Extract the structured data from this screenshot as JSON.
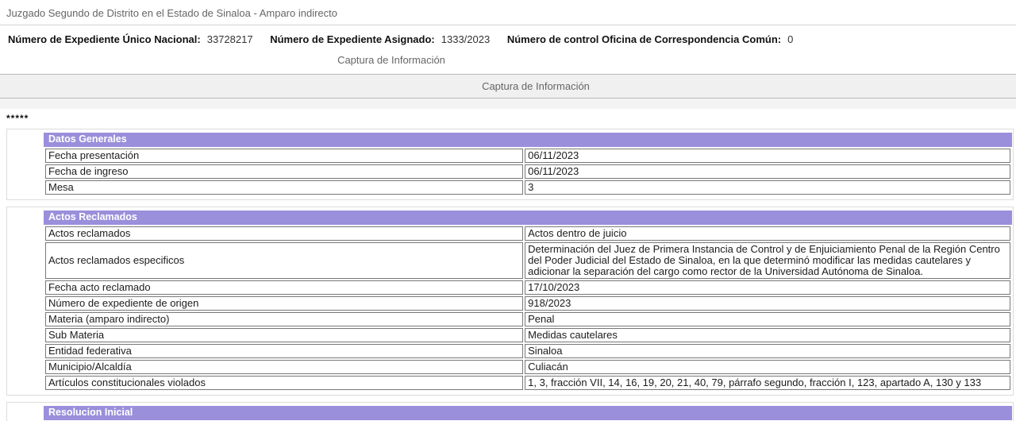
{
  "header": {
    "court_title": "Juzgado Segundo de Distrito en el Estado de Sinaloa - Amparo indirecto",
    "fields": [
      {
        "label": "Número de Expediente Único Nacional:",
        "value": "33728217"
      },
      {
        "label": "Número de Expediente Asignado:",
        "value": "1333/2023"
      },
      {
        "label": "Número de control Oficina de Correspondencia Común:",
        "value": "0"
      }
    ],
    "page_subtitle": "Captura de Información",
    "panel_tab": "Captura de Información",
    "asterisks": "*****"
  },
  "sections": [
    {
      "title": "Datos Generales",
      "rows": [
        {
          "label": "Fecha presentación",
          "value": "06/11/2023"
        },
        {
          "label": "Fecha de ingreso",
          "value": "06/11/2023"
        },
        {
          "label": "Mesa",
          "value": "3"
        }
      ]
    },
    {
      "title": "Actos Reclamados",
      "rows": [
        {
          "label": "Actos reclamados",
          "value": "Actos dentro de juicio"
        },
        {
          "label": "Actos reclamados especificos",
          "value": "Determinación del Juez de Primera Instancia de Control y de Enjuiciamiento Penal de la Región Centro del Poder Judicial del Estado de Sinaloa, en la que determinó modificar las medidas cautelares y adicionar la separación del cargo como rector de la Universidad Autónoma de Sinaloa."
        },
        {
          "label": "Fecha acto reclamado",
          "value": "17/10/2023"
        },
        {
          "label": "Número de expediente de origen",
          "value": "918/2023"
        },
        {
          "label": "Materia (amparo indirecto)",
          "value": "Penal"
        },
        {
          "label": "Sub Materia",
          "value": "Medidas cautelares"
        },
        {
          "label": "Entidad federativa",
          "value": "Sinaloa"
        },
        {
          "label": "Municipio/Alcaldía",
          "value": "Culiacán"
        },
        {
          "label": "Artículos constitucionales violados",
          "value": "1, 3, fracción VII, 14, 16, 19, 20, 21, 40, 79, párrafo segundo, fracción I, 123, apartado A, 130 y 133"
        }
      ]
    },
    {
      "title": "Resolucion Inicial",
      "rows": []
    }
  ],
  "colors": {
    "accent": "#9a8fdb",
    "band_background": "#f0f0f0",
    "cell_border": "#787878"
  }
}
